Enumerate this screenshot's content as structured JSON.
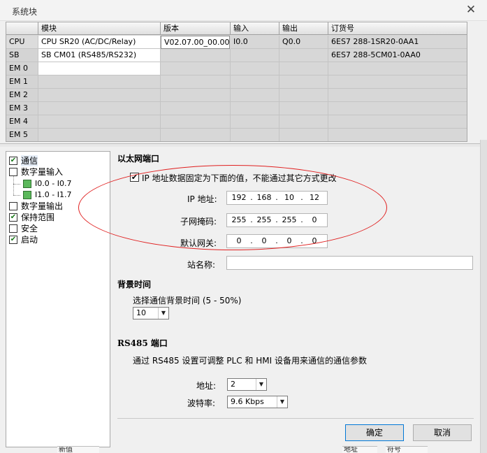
{
  "window": {
    "title": "系统块",
    "close_glyph": "✕"
  },
  "module_table": {
    "headers": [
      "",
      "模块",
      "版本",
      "输入",
      "输出",
      "订货号"
    ],
    "rows": [
      {
        "slot": "CPU",
        "module": "CPU SR20 (AC/DC/Relay)",
        "version": "V02.07.00_00.00...",
        "input": "I0.0",
        "output": "Q0.0",
        "order": "6ES7 288-1SR20-0AA1"
      },
      {
        "slot": "SB",
        "module": "SB CM01 (RS485/RS232)",
        "version": "",
        "input": "",
        "output": "",
        "order": "6ES7 288-5CM01-0AA0"
      },
      {
        "slot": "EM 0",
        "module": "",
        "version": "",
        "input": "",
        "output": "",
        "order": ""
      },
      {
        "slot": "EM 1",
        "module": "",
        "version": "",
        "input": "",
        "output": "",
        "order": ""
      },
      {
        "slot": "EM 2",
        "module": "",
        "version": "",
        "input": "",
        "output": "",
        "order": ""
      },
      {
        "slot": "EM 3",
        "module": "",
        "version": "",
        "input": "",
        "output": "",
        "order": ""
      },
      {
        "slot": "EM 4",
        "module": "",
        "version": "",
        "input": "",
        "output": "",
        "order": ""
      },
      {
        "slot": "EM 5",
        "module": "",
        "version": "",
        "input": "",
        "output": "",
        "order": ""
      }
    ]
  },
  "tree": {
    "items": [
      {
        "label": "通信",
        "state": "checked"
      },
      {
        "label": "数字量输入",
        "state": "unchecked"
      },
      {
        "label": "I0.0 - I0.7",
        "state": "green"
      },
      {
        "label": "I1.0 - I1.7",
        "state": "green"
      },
      {
        "label": "数字量输出",
        "state": "unchecked"
      },
      {
        "label": "保持范围",
        "state": "checked"
      },
      {
        "label": "安全",
        "state": "unchecked"
      },
      {
        "label": "启动",
        "state": "checked"
      }
    ],
    "check_glyph": "✔"
  },
  "ethernet": {
    "title": "以太网端口",
    "fixed_ip_label": "IP 地址数据固定为下面的值，不能通过其它方式更改",
    "fixed_ip_check_glyph": "✔",
    "ip_label": "IP 地址:",
    "ip": [
      "192",
      "168",
      "10",
      "12"
    ],
    "mask_label": "子网掩码:",
    "mask": [
      "255",
      "255",
      "255",
      "0"
    ],
    "gateway_label": "默认网关:",
    "gateway": [
      "0",
      "0",
      "0",
      "0"
    ],
    "station_label": "站名称:",
    "station_value": ""
  },
  "background_time": {
    "title": "背景时间",
    "select_label": "选择通信背景时间 (5 - 50%)",
    "value": "10"
  },
  "rs485": {
    "title": "RS485 端口",
    "description": "通过 RS485 设置可调整 PLC 和 HMI 设备用来通信的通信参数",
    "address_label": "地址:",
    "address_value": "2",
    "baud_label": "波特率:",
    "baud_value": "9.6 Kbps"
  },
  "buttons": {
    "ok": "确定",
    "cancel": "取消"
  },
  "underlap": {
    "left_text": "新值",
    "right_a": "地址",
    "right_b": "符号"
  },
  "glyphs": {
    "dropdown": "▼",
    "ip_dot": "."
  },
  "colors": {
    "annotation": "#e02020",
    "checkbox_green": "#5bb85b"
  }
}
